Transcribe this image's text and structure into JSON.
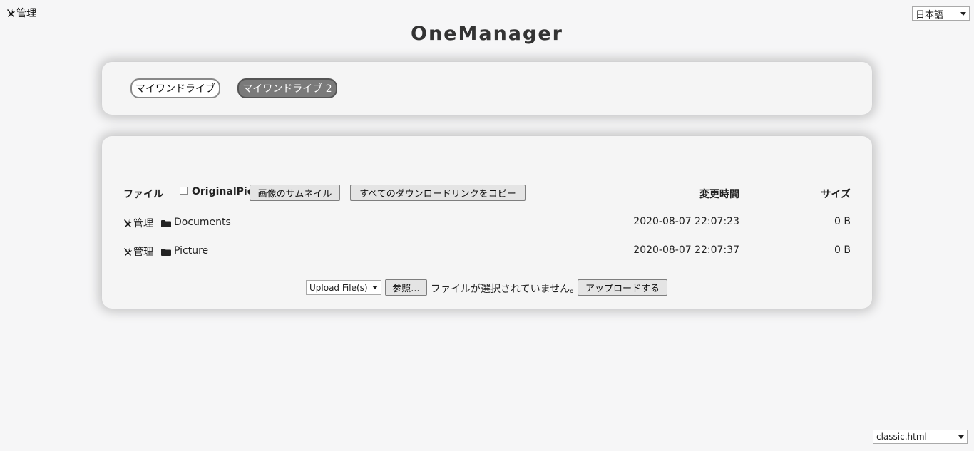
{
  "top_bar": {
    "admin_label": "管理",
    "language_selected": "日本語"
  },
  "site_title": "OneManager",
  "drives": [
    {
      "label": "マイワンドライブ",
      "active": false
    },
    {
      "label": "マイワンドライブ 2",
      "active": true
    }
  ],
  "file_list": {
    "header": {
      "name": "ファイル",
      "original_pic": "OriginalPic",
      "thumbnail_button": "画像のサムネイル",
      "copy_links_button": "すべてのダウンロードリンクをコピー",
      "modified": "変更時間",
      "size": "サイズ"
    },
    "rows": [
      {
        "admin": "管理",
        "name": "Documents",
        "modified": "2020-08-07 22:07:23",
        "size": "0 B"
      },
      {
        "admin": "管理",
        "name": "Picture",
        "modified": "2020-08-07 22:07:37",
        "size": "0 B"
      }
    ]
  },
  "upload": {
    "mode_selected": "Upload File(s)",
    "browse_button": "参照...",
    "no_file_text": "ファイルが選択されていません。",
    "upload_button": "アップロードする"
  },
  "template_selected": "classic.html",
  "icons": {
    "admin": "tools-icon",
    "folder": "folder-icon"
  }
}
